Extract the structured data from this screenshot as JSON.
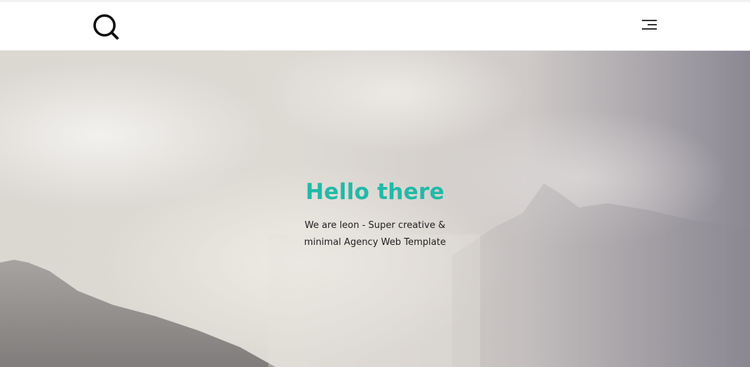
{
  "header": {
    "logo_icon": "search-icon",
    "menu_icon": "hamburger-menu-icon"
  },
  "hero": {
    "title": "Hello there",
    "subtitle_line1": "We are leon - Super creative &",
    "subtitle_line2": "minimal Agency Web Template"
  },
  "colors": {
    "accent": "#21b9a8",
    "text": "#1f1f1f",
    "header_bg": "#ffffff"
  }
}
